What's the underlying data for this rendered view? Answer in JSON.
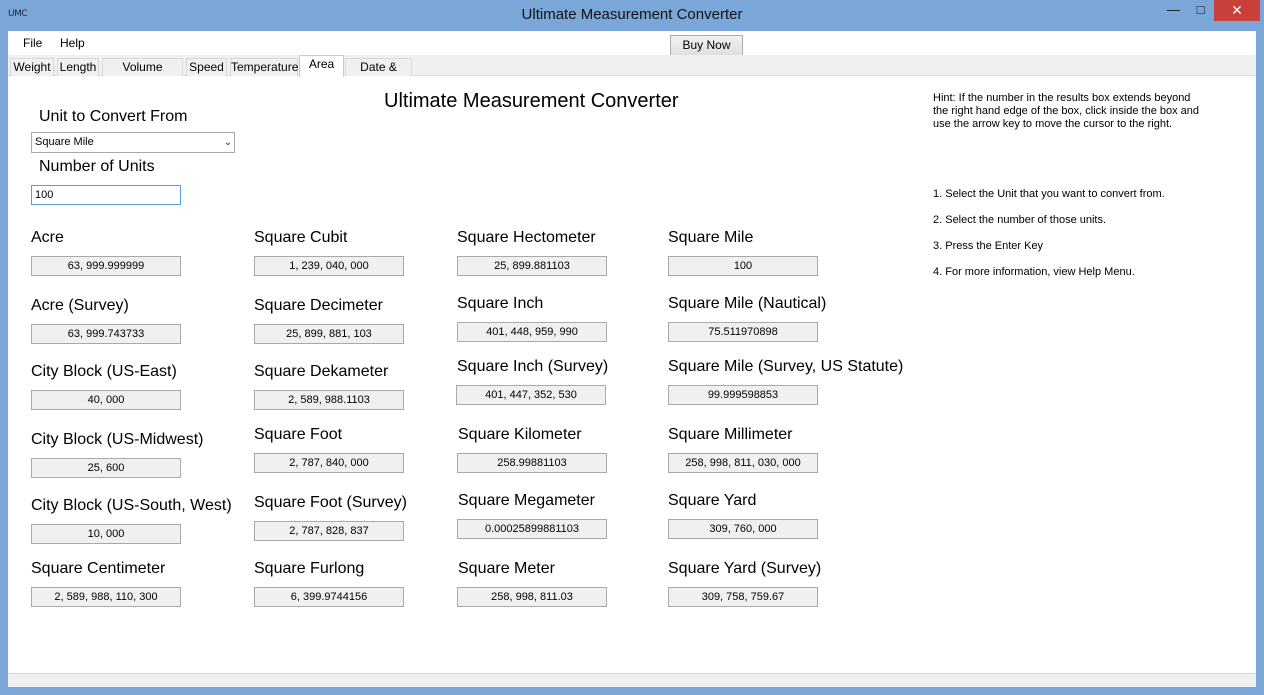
{
  "window": {
    "icon_text": "UMC",
    "title": "Ultimate Measurement Converter",
    "minimize_glyph": "—",
    "maximize_glyph": "□",
    "close_glyph": "✕"
  },
  "menu": {
    "file": "File",
    "help": "Help",
    "buy_now": "Buy Now"
  },
  "tabs": [
    "Weight",
    "Length",
    "Volume (Liquid)",
    "Speed",
    "Temperature",
    "Area",
    "Date & Time"
  ],
  "active_tab": "Area",
  "main": {
    "title": "Ultimate Measurement Converter",
    "from_label": "Unit to Convert From",
    "from_value": "Square Mile",
    "units_label": "Number of Units",
    "units_value": "100",
    "hint": "Hint: If the number in the results box extends beyond the right hand edge of the box, click inside the box and use the arrow key to move the cursor to the right.",
    "steps": [
      "1. Select the Unit that you want to convert from.",
      "2. Select the number of those units.",
      "3. Press the Enter Key",
      "4. For more information, view Help Menu."
    ]
  },
  "results": [
    [
      {
        "label": "Acre",
        "value": "63, 999.999999"
      },
      {
        "label": "Acre (Survey)",
        "value": "63, 999.743733"
      },
      {
        "label": "City Block (US-East)",
        "value": "40, 000"
      },
      {
        "label": "City Block (US-Midwest)",
        "value": "25, 600"
      },
      {
        "label": "City Block (US-South, West)",
        "value": "10, 000"
      },
      {
        "label": "Square Centimeter",
        "value": "2, 589, 988, 110, 300"
      }
    ],
    [
      {
        "label": "Square Cubit",
        "value": "1, 239, 040, 000"
      },
      {
        "label": "Square Decimeter",
        "value": "25, 899, 881, 103"
      },
      {
        "label": "Square Dekameter",
        "value": "2, 589, 988.1103"
      },
      {
        "label": "Square Foot",
        "value": "2, 787, 840, 000"
      },
      {
        "label": "Square Foot (Survey)",
        "value": "2, 787, 828, 837"
      },
      {
        "label": "Square Furlong",
        "value": "6, 399.9744156"
      }
    ],
    [
      {
        "label": "Square Hectometer",
        "value": "25, 899.881103"
      },
      {
        "label": "Square Inch",
        "value": "401, 448, 959, 990"
      },
      {
        "label": "Square Inch (Survey)",
        "value": "401, 447, 352, 530"
      },
      {
        "label": "Square Kilometer",
        "value": "258.99881103"
      },
      {
        "label": "Square Megameter",
        "value": "0.00025899881103"
      },
      {
        "label": "Square Meter",
        "value": "258, 998, 811.03"
      }
    ],
    [
      {
        "label": "Square Mile",
        "value": "100"
      },
      {
        "label": "Square Mile (Nautical)",
        "value": "75.511970898"
      },
      {
        "label": "Square Mile (Survey, US Statute)",
        "value": "99.999598853"
      },
      {
        "label": "Square Millimeter",
        "value": "258, 998, 811, 030, 000"
      },
      {
        "label": "Square Yard",
        "value": "309, 760, 000"
      },
      {
        "label": "Square Yard (Survey)",
        "value": "309, 758, 759.67"
      }
    ]
  ]
}
